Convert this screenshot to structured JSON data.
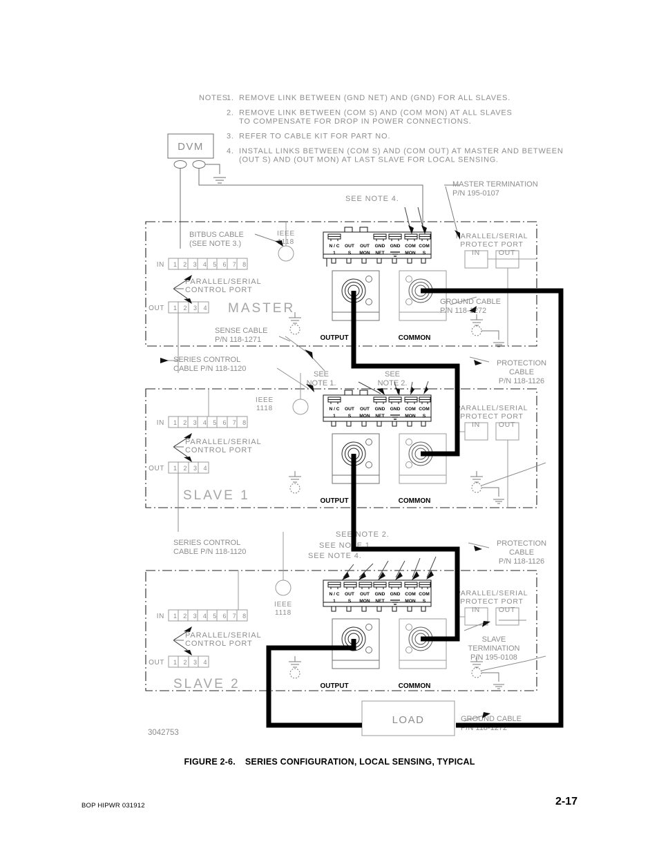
{
  "figure": {
    "number": "FIGURE 2-6.",
    "title": "SERIES CONFIGURATION, LOCAL SENSING, TYPICAL",
    "drawing_number": "3042753"
  },
  "footer": {
    "left": "BOP HIPWR 031912",
    "page": "2-17"
  },
  "notes": {
    "heading": "NOTES:",
    "items": [
      {
        "num": "1.",
        "lines": [
          "REMOVE LINK BETWEEN (GND NET) AND (GND) FOR ALL SLAVES."
        ]
      },
      {
        "num": "2.",
        "lines": [
          "REMOVE LINK BETWEEN (COM S) AND (COM MON) AT ALL SLAVES",
          "TO COMPENSATE FOR DROP IN POWER CONNECTIONS."
        ]
      },
      {
        "num": "3.",
        "lines": [
          "REFER TO CABLE KIT FOR PART NO."
        ]
      },
      {
        "num": "4.",
        "lines": [
          "INSTALL LINKS BETWEEN (COM S) AND (COM OUT) AT MASTER AND BETWEEN",
          "(OUT S) AND (OUT MON) AT LAST SLAVE FOR LOCAL SENSING."
        ]
      }
    ]
  },
  "instruments": {
    "dvm": "DVM",
    "load": "LOAD"
  },
  "terminal_strip": {
    "labels": [
      {
        "top": "N / C",
        "bottom": "1"
      },
      {
        "top": "OUT",
        "bottom": "S"
      },
      {
        "top": "OUT",
        "bottom": "MON"
      },
      {
        "top": "GND",
        "bottom": "NET"
      },
      {
        "top": "GND",
        "bottom": "gnd-symbol"
      },
      {
        "top": "COM",
        "bottom": "MON"
      },
      {
        "top": "COM",
        "bottom": "S"
      }
    ]
  },
  "units": [
    {
      "id": "master",
      "name": "MASTER",
      "ieee": {
        "line1": "IEEE",
        "line2": "1118"
      },
      "in_label": "IN",
      "out_label": "OUT",
      "in_pins": [
        "1",
        "2",
        "3",
        "4",
        "5",
        "6",
        "7",
        "8"
      ],
      "out_pins": [
        "1",
        "2",
        "3",
        "4"
      ],
      "control_port": [
        "PARALLEL/SERIAL",
        "CONTROL PORT"
      ],
      "protect_port": [
        "PARALLEL/SERIAL",
        "PROTECT PORT"
      ],
      "protect_in": "IN",
      "protect_out": "OUT",
      "output_label": "OUTPUT",
      "common_label": "COMMON"
    },
    {
      "id": "slave1",
      "name": "SLAVE 1",
      "ieee": {
        "line1": "IEEE",
        "line2": "1118"
      },
      "in_label": "IN",
      "out_label": "OUT",
      "in_pins": [
        "1",
        "2",
        "3",
        "4",
        "5",
        "6",
        "7",
        "8"
      ],
      "out_pins": [
        "1",
        "2",
        "3",
        "4"
      ],
      "control_port": [
        "PARALLEL/SERIAL",
        "CONTROL PORT"
      ],
      "protect_port": [
        "PARALLEL/SERIAL",
        "PROTECT PORT"
      ],
      "protect_in": "IN",
      "protect_out": "OUT",
      "output_label": "OUTPUT",
      "common_label": "COMMON"
    },
    {
      "id": "slave2",
      "name": "SLAVE 2",
      "ieee": {
        "line1": "IEEE",
        "line2": "1118"
      },
      "in_label": "IN",
      "out_label": "OUT",
      "in_pins": [
        "1",
        "2",
        "3",
        "4",
        "5",
        "6",
        "7",
        "8"
      ],
      "out_pins": [
        "1",
        "2",
        "3",
        "4"
      ],
      "control_port": [
        "PARALLEL/SERIAL",
        "CONTROL PORT"
      ],
      "protect_port": [
        "PARALLEL/SERIAL",
        "PROTECT PORT"
      ],
      "protect_in": "IN",
      "protect_out": "OUT",
      "output_label": "OUTPUT",
      "common_label": "COMMON"
    }
  ],
  "callouts": {
    "bitbus": [
      "BITBUS CABLE",
      "(SEE NOTE 3.)"
    ],
    "sense_cable": [
      "SENSE CABLE",
      "P/N 118-1271"
    ],
    "series_control_1": [
      "SERIES CONTROL",
      "CABLE P/N 118-1120"
    ],
    "series_control_2": [
      "SERIES CONTROL",
      "CABLE P/N 118-1120"
    ],
    "master_termination": [
      "MASTER TERMINATION",
      "P/N 195-0107"
    ],
    "slave_termination": [
      "SLAVE",
      "TERMINATION",
      "P/N 195-0108"
    ],
    "ground_cable_top": [
      "GROUND CABLE",
      "P/N 118-1272"
    ],
    "ground_cable_bottom": [
      "GROUND CABLE",
      "P/N 118-1272"
    ],
    "protection_cable_1": [
      "PROTECTION",
      "CABLE",
      "P/N 118-1126"
    ],
    "protection_cable_2": [
      "PROTECTION",
      "CABLE",
      "P/N 118-1126"
    ],
    "see_note_4_top": "SEE NOTE 4.",
    "see_note_1_mid": [
      "SEE",
      "NOTE 1."
    ],
    "see_note_2_mid": [
      "SEE",
      "NOTE 2."
    ],
    "see_note_2_low": "SEE NOTE 2.",
    "see_note_1_low": "SEE NOTE 1.",
    "see_note_4_low": "SEE NOTE 4."
  },
  "colors": {
    "line": "#3a3a3a",
    "faint": "#9a9a9a",
    "heavy": "#000000",
    "text_dark": "#000000",
    "text_faint": "#8d8d8d"
  }
}
